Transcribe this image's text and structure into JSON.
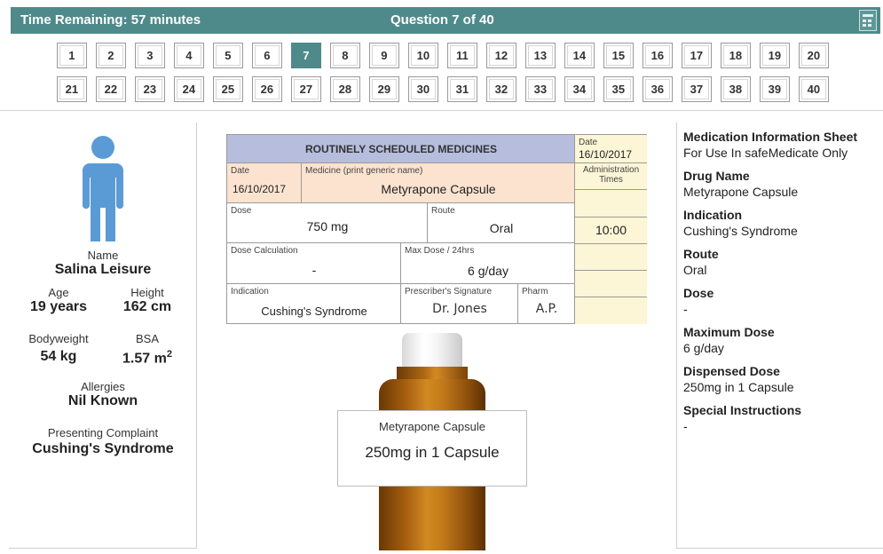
{
  "header": {
    "time_remaining": "Time Remaining: 57 minutes",
    "question_position": "Question 7 of 40",
    "calculator_icon": "calculator-icon",
    "bar_color": "#4f8a8b"
  },
  "questions": {
    "row1": [
      "1",
      "2",
      "3",
      "4",
      "5",
      "6",
      "7",
      "8",
      "9",
      "10",
      "11",
      "12",
      "13",
      "14",
      "15",
      "16",
      "17",
      "18",
      "19",
      "20"
    ],
    "row2": [
      "21",
      "22",
      "23",
      "24",
      "25",
      "26",
      "27",
      "28",
      "29",
      "30",
      "31",
      "32",
      "33",
      "34",
      "35",
      "36",
      "37",
      "38",
      "39",
      "40"
    ],
    "active": "7"
  },
  "patient": {
    "icon": "person-icon",
    "icon_color": "#5b9bd5",
    "name_label": "Name",
    "name": "Salina Leisure",
    "age_label": "Age",
    "age": "19 years",
    "height_label": "Height",
    "height": "162 cm",
    "bodyweight_label": "Bodyweight",
    "bodyweight": "54 kg",
    "bsa_label": "BSA",
    "bsa_value": "1.57 m",
    "bsa_exp": "2",
    "allergies_label": "Allergies",
    "allergies": "Nil Known",
    "complaint_label": "Presenting Complaint",
    "complaint": "Cushing's Syndrome"
  },
  "chart": {
    "title": "ROUTINELY SCHEDULED MEDICINES",
    "date_label": "Date",
    "date_top": "16/10/2017",
    "date": "16/10/2017",
    "medicine_label": "Medicine (print generic name)",
    "medicine": "Metyrapone Capsule",
    "admin_times_label": "Administration Times",
    "dose_label": "Dose",
    "dose": "750 mg",
    "route_label": "Route",
    "route": "Oral",
    "time": "10:00",
    "dose_calc_label": "Dose Calculation",
    "dose_calc": "-",
    "max_dose_label": "Max Dose / 24hrs",
    "max_dose": "6 g/day",
    "indication_label": "Indication",
    "indication": "Cushing's Syndrome",
    "signature_label": "Prescriber's Signature",
    "signature": "Dr. Jones",
    "pharm_label": "Pharm",
    "pharm": "A.P.",
    "header_color": "#b7bedd",
    "medicine_row_color": "#fbe3cf",
    "times_color": "#fdf6d6"
  },
  "bottle": {
    "label_name": "Metyrapone Capsule",
    "label_strength": "250mg in 1 Capsule"
  },
  "info": {
    "title": "Medication Information Sheet",
    "subtitle": "For Use In safeMedicate Only",
    "drug_name_h": "Drug Name",
    "drug_name": "Metyrapone Capsule",
    "indication_h": "Indication",
    "indication": "Cushing's Syndrome",
    "route_h": "Route",
    "route": "Oral",
    "dose_h": "Dose",
    "dose": "-",
    "max_dose_h": "Maximum Dose",
    "max_dose": "6 g/day",
    "dispensed_h": "Dispensed Dose",
    "dispensed": "250mg in 1 Capsule",
    "special_h": "Special Instructions",
    "special": "-"
  }
}
